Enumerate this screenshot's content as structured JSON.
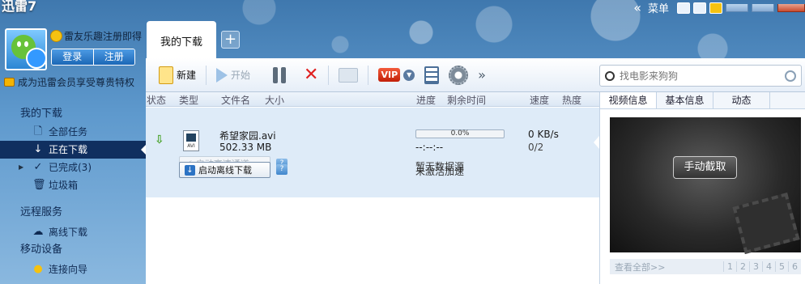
{
  "app": {
    "title": "迅雷7"
  },
  "window": {
    "menu_label": "菜单",
    "chevron": "«"
  },
  "user": {
    "name": "雷友乐趣注册即得",
    "login_label": "登录",
    "register_label": "注册",
    "vip_promo": "成为迅雷会员享受尊贵特权"
  },
  "sidebar": {
    "sections": [
      {
        "label": "我的下载"
      },
      {
        "label": "远程服务"
      },
      {
        "label": "移动设备"
      }
    ],
    "items": [
      {
        "label": "全部任务",
        "icon": "doc-icon"
      },
      {
        "label": "正在下载",
        "icon": "arrow-down-icon"
      },
      {
        "label": "已完成(3)",
        "icon": "check-icon"
      },
      {
        "label": "垃圾箱",
        "icon": "trash-icon"
      },
      {
        "label": "离线下载",
        "icon": "cloud-icon"
      },
      {
        "label": "连接向导",
        "icon": "bulb-icon"
      }
    ]
  },
  "tabs": {
    "main": "我的下载",
    "add": "+"
  },
  "toolbar": {
    "new_label": "新建",
    "start_label": "开始",
    "more": "»",
    "vip_label": "VIP"
  },
  "search": {
    "placeholder": "找电影来狗狗"
  },
  "list": {
    "headers": [
      "状态",
      "类型",
      "文件名",
      "大小",
      "进度",
      "剩余时间",
      "速度",
      "热度"
    ],
    "tasks": [
      {
        "file_name": "希望家园.avi",
        "file_size": "502.33 MB",
        "file_type": "AVI",
        "progress_text": "0.0%",
        "progress": 0.0,
        "remaining": "--:--:--",
        "speed": "0 KB/s",
        "peers": "0/2",
        "accel_label": "启动高速通道",
        "accel_status": "暂无数据源",
        "offline_label": "启动离线下载",
        "offline_status": "未激活加速"
      }
    ]
  },
  "right_panel": {
    "tabs": [
      "视频信息",
      "基本信息",
      "动态"
    ],
    "snapshot_label": "手动截取",
    "view_all": "查看全部>>",
    "pages": [
      "1",
      "2",
      "3",
      "4",
      "5",
      "6"
    ]
  },
  "colors": {
    "accent": "#102f5f",
    "progress_border": "#9fb1c4",
    "delete": "#e02020"
  }
}
